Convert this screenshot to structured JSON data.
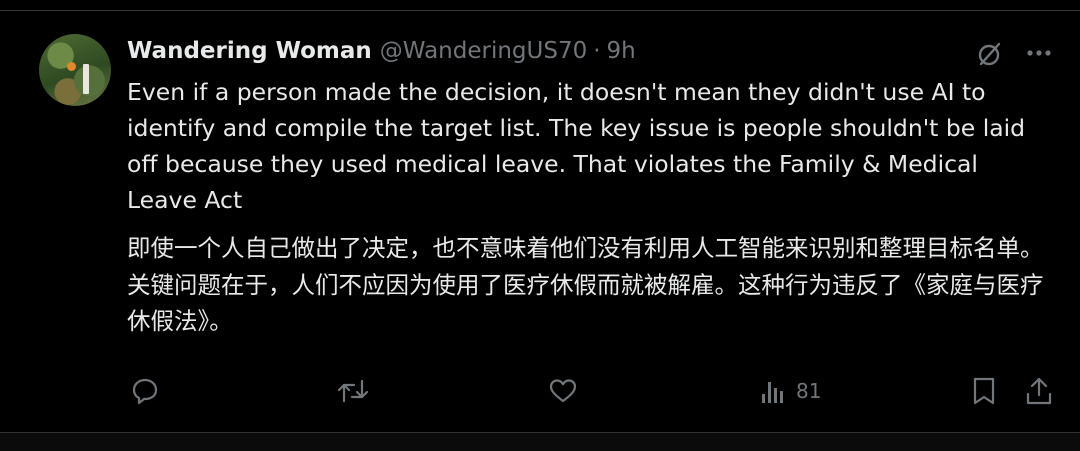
{
  "tweet": {
    "author_name": "Wandering Woman",
    "author_handle": "@WanderingUS70",
    "separator": "·",
    "time": "9h",
    "text_en": "Even if a person made the decision, it doesn't mean they didn't use AI to identify and compile the target list. The key issue is people shouldn't be laid off because they used medical leave. That violates the Family & Medical Leave Act",
    "text_zh": "即使一个人自己做出了决定，也不意味着他们没有利用人工智能来识别和整理目标名单。关键问题在于，人们不应因为使用了医疗休假而就被解雇。这种行为违反了《家庭与医疗休假法》。"
  },
  "actions": {
    "views_count": "81"
  },
  "icons": {
    "avatar": "avatar-photo",
    "grok": "grok-icon",
    "more": "more-icon",
    "reply": "reply-icon",
    "retweet": "retweet-icon",
    "like": "like-icon",
    "views": "views-icon",
    "bookmark": "bookmark-icon",
    "share": "share-icon"
  },
  "colors": {
    "background": "#000000",
    "text_primary": "#e7e9ea",
    "text_secondary": "#71767b",
    "divider": "#2f3336"
  }
}
